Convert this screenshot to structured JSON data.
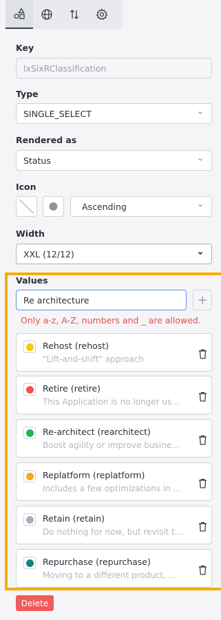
{
  "tabs": [
    {
      "icon": "shapes-icon",
      "active": true
    },
    {
      "icon": "globe-icon"
    },
    {
      "icon": "sort-icon"
    },
    {
      "icon": "gear-icon"
    }
  ],
  "key": {
    "label": "Key",
    "placeholder": "lxSixRClassification"
  },
  "type": {
    "label": "Type",
    "value": "SINGLE_SELECT"
  },
  "rendered_as": {
    "label": "Rendered as",
    "value": "Status"
  },
  "icon": {
    "label": "Icon",
    "order": "Ascending"
  },
  "width": {
    "label": "Width",
    "value": "XXL (12/12)"
  },
  "values": {
    "label": "Values",
    "input_value": "Re architecture",
    "add": "+",
    "error": "Only a-z, A-Z, numbers and _ are allowed.",
    "items": [
      {
        "title": "Rehost (rehost)",
        "desc": "\"Lift-and-shift\" approach",
        "color": "#f5cd00"
      },
      {
        "title": "Retire (retire)",
        "desc": "This Application is no longer useful, ...",
        "color": "#ef5458"
      },
      {
        "title": "Re-architect (rearchitect)",
        "desc": "Boost agility or improve business co...",
        "color": "#22b24c"
      },
      {
        "title": "Replatform (replatform)",
        "desc": "Includes a few optimizations in orde...",
        "color": "#f5a920"
      },
      {
        "title": "Retain (retain)",
        "desc": "Do nothing for now, but revisit this A...",
        "color": "#a9b0bf"
      },
      {
        "title": "Repurchase (repurchase)",
        "desc": "Moving to a different product, most...",
        "color": "#128779"
      }
    ]
  },
  "delete_label": "Delete",
  "colors": {
    "accent_frame": "#f5ad00",
    "focus": "#5a8fe6",
    "danger": "#f05a5b"
  }
}
